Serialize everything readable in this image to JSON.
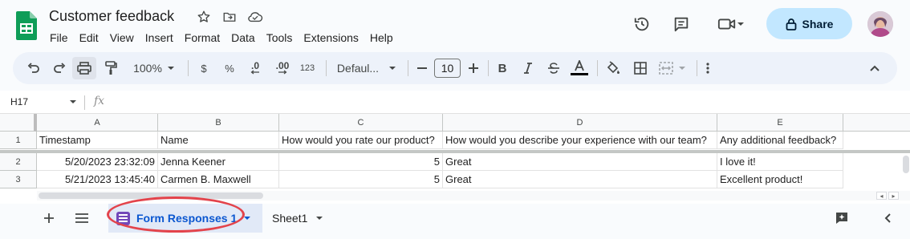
{
  "app": {
    "title": "Customer feedback",
    "share_label": "Share",
    "menu": [
      "File",
      "Edit",
      "View",
      "Insert",
      "Format",
      "Data",
      "Tools",
      "Extensions",
      "Help"
    ]
  },
  "toolbar": {
    "zoom": "100%",
    "currency": "$",
    "percent": "%",
    "dec_decrease": ".0",
    "dec_increase": ".00",
    "number_format": "123",
    "font_name": "Defaul...",
    "font_size": "10",
    "bold": "B"
  },
  "formula_bar": {
    "cell_ref": "H17",
    "fx_label": "fx"
  },
  "grid": {
    "columns": [
      "A",
      "B",
      "C",
      "D",
      "E"
    ],
    "rows": [
      {
        "num": "1",
        "cells": [
          "Timestamp",
          "Name",
          "How would you rate our product?",
          "How would you describe your experience with our team?",
          "Any additional feedback?"
        ]
      },
      {
        "num": "2",
        "cells": [
          "5/20/2023 23:32:09",
          "Jenna Keener",
          "5",
          "Great",
          "I love it!"
        ]
      },
      {
        "num": "3",
        "cells": [
          "5/21/2023 13:45:40",
          "Carmen B. Maxwell",
          "5",
          "Great",
          "Excellent product!"
        ]
      }
    ]
  },
  "sheet_tabs": {
    "active": "Form Responses 1",
    "other": "Sheet1"
  },
  "colors": {
    "brand_green": "#0f9d58",
    "share_bg": "#c2e7ff",
    "active_tab_text": "#0b57d0",
    "highlight": "#e3434b"
  }
}
